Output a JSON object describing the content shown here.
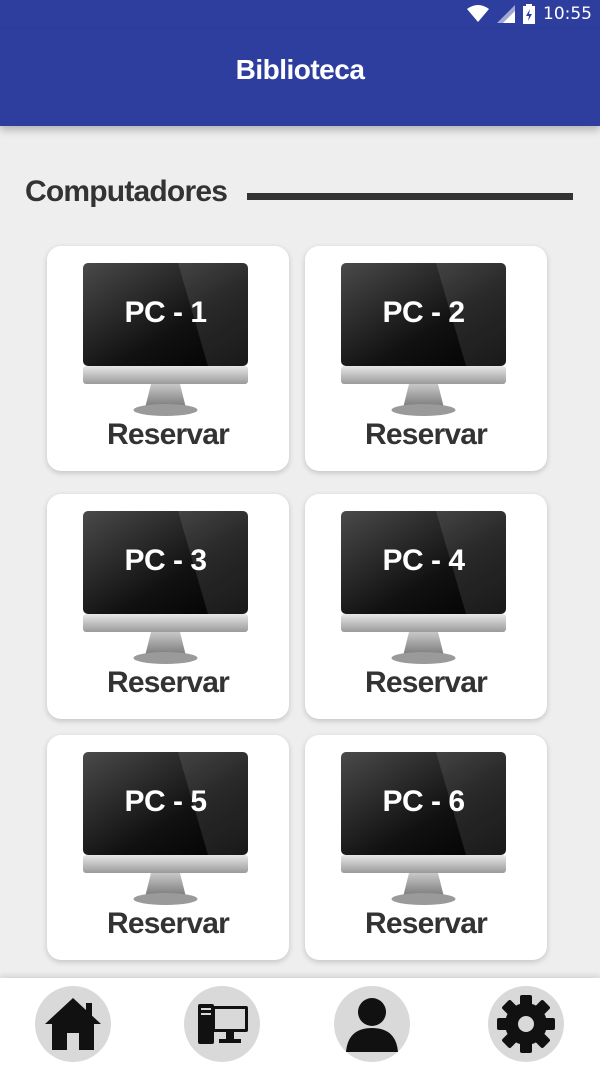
{
  "status_bar": {
    "time": "10:55"
  },
  "app_bar": {
    "title": "Biblioteca"
  },
  "section": {
    "title": "Computadores"
  },
  "computers": [
    {
      "label": "PC - 1",
      "action": "Reservar"
    },
    {
      "label": "PC - 2",
      "action": "Reservar"
    },
    {
      "label": "PC - 3",
      "action": "Reservar"
    },
    {
      "label": "PC - 4",
      "action": "Reservar"
    },
    {
      "label": "PC - 5",
      "action": "Reservar"
    },
    {
      "label": "PC - 6",
      "action": "Reservar"
    }
  ],
  "bottom_nav": {
    "items": [
      {
        "icon": "home-icon"
      },
      {
        "icon": "computer-icon"
      },
      {
        "icon": "user-icon"
      },
      {
        "icon": "gear-icon"
      }
    ]
  },
  "colors": {
    "primary": "#2e3e9e",
    "background": "#eeeeee",
    "card": "#ffffff",
    "text": "#333333"
  }
}
